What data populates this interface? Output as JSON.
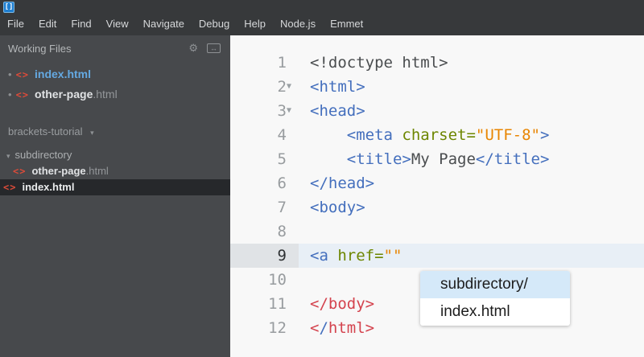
{
  "menu": {
    "items": [
      "File",
      "Edit",
      "Find",
      "View",
      "Navigate",
      "Debug",
      "Help",
      "Node.js",
      "Emmet"
    ]
  },
  "sidebar": {
    "working_files": {
      "title": "Working Files",
      "files": [
        {
          "name": "index.html",
          "ext": "",
          "modified": true,
          "active": true
        },
        {
          "name": "other-page",
          "ext": ".html",
          "modified": true,
          "active": false
        }
      ]
    },
    "project": {
      "name": "brackets-tutorial",
      "tree": [
        {
          "type": "folder",
          "label": "subdirectory",
          "expanded": true
        },
        {
          "type": "file",
          "name": "other-page",
          "ext": ".html",
          "level": 1,
          "selected": false
        },
        {
          "type": "file",
          "name": "index.html",
          "ext": "",
          "level": 0,
          "selected": true
        }
      ]
    }
  },
  "editor": {
    "active_line": 9,
    "lines": [
      {
        "n": 1,
        "fold": false,
        "tokens": [
          [
            "plain",
            "<!doctype html>"
          ]
        ]
      },
      {
        "n": 2,
        "fold": true,
        "tokens": [
          [
            "tag",
            "<html>"
          ]
        ]
      },
      {
        "n": 3,
        "fold": true,
        "tokens": [
          [
            "tag",
            "<head>"
          ]
        ]
      },
      {
        "n": 4,
        "fold": false,
        "tokens": [
          [
            "plain",
            "    "
          ],
          [
            "tag",
            "<meta"
          ],
          [
            "attr",
            " charset="
          ],
          [
            "str",
            "\"UTF-8\""
          ],
          [
            "tag",
            ">"
          ]
        ]
      },
      {
        "n": 5,
        "fold": false,
        "tokens": [
          [
            "plain",
            "    "
          ],
          [
            "tag",
            "<title>"
          ],
          [
            "plain",
            "My Page"
          ],
          [
            "tag",
            "</title>"
          ]
        ]
      },
      {
        "n": 6,
        "fold": false,
        "tokens": [
          [
            "tag",
            "</head>"
          ]
        ]
      },
      {
        "n": 7,
        "fold": false,
        "tokens": [
          [
            "tag",
            "<body>"
          ]
        ]
      },
      {
        "n": 8,
        "fold": false,
        "tokens": []
      },
      {
        "n": 9,
        "fold": false,
        "tokens": [
          [
            "tag",
            "<a"
          ],
          [
            "attr",
            " href="
          ],
          [
            "str",
            "\"\""
          ]
        ]
      },
      {
        "n": 10,
        "fold": false,
        "tokens": []
      },
      {
        "n": 11,
        "fold": false,
        "tokens": [
          [
            "err",
            "</body>"
          ]
        ]
      },
      {
        "n": 12,
        "fold": false,
        "tokens": [
          [
            "err",
            "<"
          ],
          [
            "tag",
            "/"
          ],
          [
            "err",
            "html>"
          ]
        ]
      }
    ]
  },
  "hints": {
    "items": [
      {
        "label": "subdirectory/",
        "selected": true
      },
      {
        "label": "index.html",
        "selected": false
      }
    ]
  },
  "icons": {
    "logo": "[]",
    "gear": "⚙",
    "split_view": "↔",
    "modified_dot": "•",
    "file_code": "<>",
    "collapse_arrow": "▾",
    "dropdown_arrow": "▾",
    "fold_arrow": "▼"
  },
  "colors": {
    "menubar_bg": "#37393b",
    "sidebar_bg": "#47494c",
    "selected_row_bg": "#26282b",
    "editor_bg": "#f8f8f8",
    "active_line_bg": "#e8eff6",
    "active_gutter_bg": "#e0e3e6",
    "hint_selected_bg": "#d5e9f9",
    "tag": "#446fbd",
    "attr": "#6d8600",
    "string": "#e88501",
    "plain": "#4a4d4f",
    "error": "#d4434e",
    "working_file_active": "#64a9e2",
    "file_icon": "#dd4b39"
  }
}
